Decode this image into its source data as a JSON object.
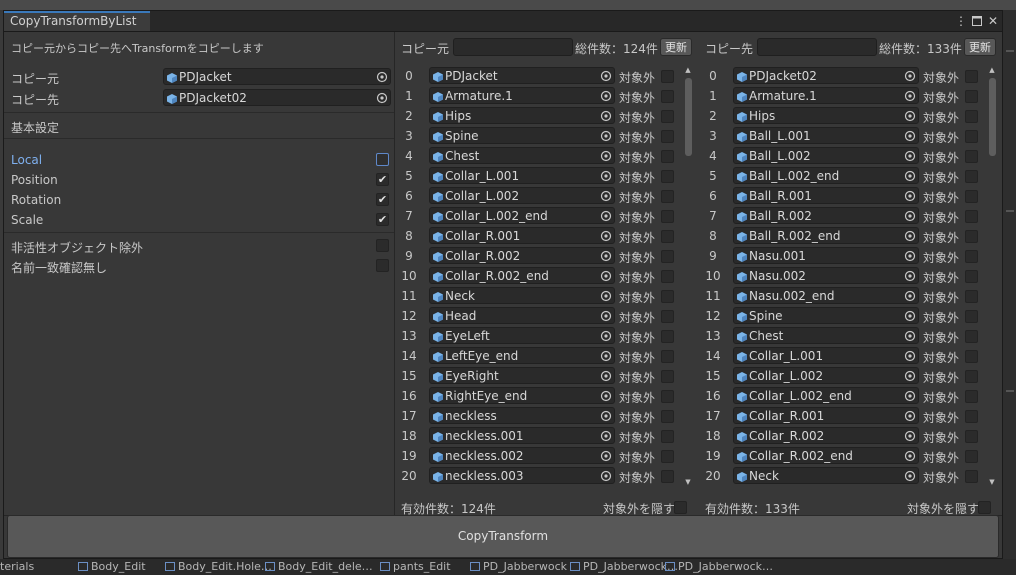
{
  "window": {
    "tab_title": "CopyTransformByList",
    "menu_icon": "kebab-menu-icon",
    "maximize_icon": "maximize-icon",
    "close_icon": "close-icon"
  },
  "left": {
    "description": "コピー元からコピー先へTransformをコピーします",
    "source_label": "コピー元",
    "source_value": "PDJacket",
    "dest_label": "コピー先",
    "dest_value": "PDJacket02",
    "section_title": "基本設定",
    "options": [
      {
        "label": "Local",
        "checked": false
      },
      {
        "label": "Position",
        "checked": true
      },
      {
        "label": "Rotation",
        "checked": true
      },
      {
        "label": "Scale",
        "checked": true
      }
    ],
    "extra_options": [
      {
        "label": "非活性オブジェクト除外",
        "checked": false
      },
      {
        "label": "名前一致確認無し",
        "checked": false
      }
    ]
  },
  "source_panel": {
    "header": "コピー元",
    "total": "総件数：124件",
    "refresh": "更新",
    "exclude_label": "対象外",
    "items": [
      "PDJacket",
      "Armature.1",
      "Hips",
      "Spine",
      "Chest",
      "Collar_L.001",
      "Collar_L.002",
      "Collar_L.002_end",
      "Collar_R.001",
      "Collar_R.002",
      "Collar_R.002_end",
      "Neck",
      "Head",
      "EyeLeft",
      "LeftEye_end",
      "EyeRight",
      "RightEye_end",
      "neckless",
      "neckless.001",
      "neckless.002",
      "neckless.003"
    ],
    "valid_count": "有効件数：124件",
    "hide_excluded": "対象外を隠す"
  },
  "dest_panel": {
    "header": "コピー先",
    "total": "総件数：133件",
    "refresh": "更新",
    "exclude_label": "対象外",
    "items": [
      "PDJacket02",
      "Armature.1",
      "Hips",
      "Ball_L.001",
      "Ball_L.002",
      "Ball_L.002_end",
      "Ball_R.001",
      "Ball_R.002",
      "Ball_R.002_end",
      "Nasu.001",
      "Nasu.002",
      "Nasu.002_end",
      "Spine",
      "Chest",
      "Collar_L.001",
      "Collar_L.002",
      "Collar_L.002_end",
      "Collar_R.001",
      "Collar_R.002",
      "Collar_R.002_end",
      "Neck"
    ],
    "valid_count": "有効件数：133件",
    "hide_excluded": "対象外を隠す"
  },
  "copy_button": "CopyTransform",
  "statusbar": [
    "terials",
    "Body_Edit",
    "Body_Edit.Hole…",
    "Body_Edit_dele…",
    "pants_Edit",
    "PD_Jabberwock",
    "PD_Jabberwock…",
    "PD_Jabberwock…"
  ],
  "accent_color": "#3a79bb"
}
